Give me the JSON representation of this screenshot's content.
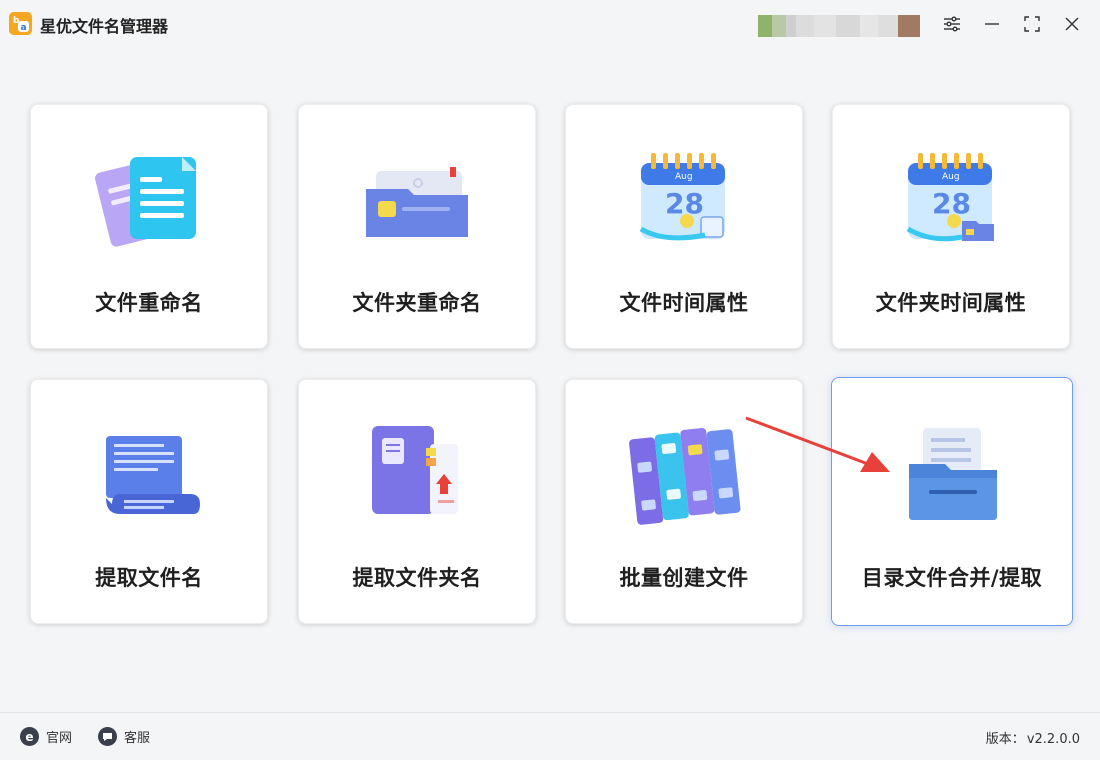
{
  "app": {
    "title": "星优文件名管理器",
    "logo_icon": "app-logo-icon"
  },
  "window_controls": [
    {
      "name": "settings-icon"
    },
    {
      "name": "minimize-icon"
    },
    {
      "name": "maximize-icon"
    },
    {
      "name": "close-icon"
    }
  ],
  "cards": [
    {
      "label": "文件重命名",
      "icon": "documents-icon"
    },
    {
      "label": "文件夹重命名",
      "icon": "folder-icon"
    },
    {
      "label": "文件时间属性",
      "icon": "calendar-icon"
    },
    {
      "label": "文件夹时间属性",
      "icon": "calendar-folder-icon"
    },
    {
      "label": "提取文件名",
      "icon": "scroll-document-icon"
    },
    {
      "label": "提取文件夹名",
      "icon": "book-folder-icon"
    },
    {
      "label": "批量创建文件",
      "icon": "binders-icon"
    },
    {
      "label": "目录文件合并/提取",
      "icon": "file-tray-icon",
      "selected": true
    }
  ],
  "footer": {
    "website_label": "官网",
    "support_label": "客服",
    "version_label": "版本：",
    "version": "v2.2.0.0"
  },
  "colors": {
    "accent": "#6f9ef0",
    "arrow": "#e8413a",
    "logo": "#f5a623"
  }
}
